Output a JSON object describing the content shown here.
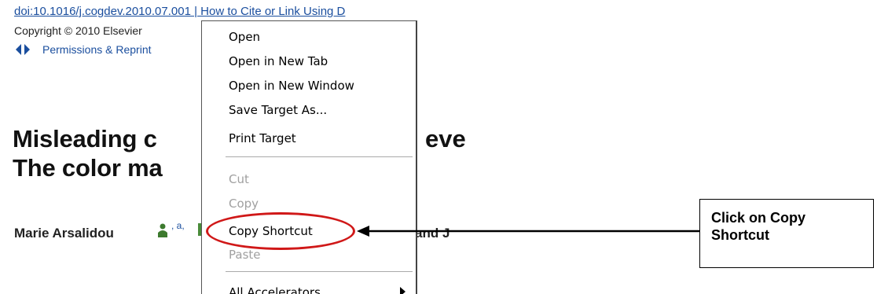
{
  "page": {
    "doi_link": "doi:10.1016/j.cogdev.2010.07.001 | How to Cite or Link Using D",
    "copyright": "Copyright © 2010 Elsevier",
    "permissions": "Permissions & Reprint",
    "title_line1": "Misleading c",
    "title_line1_tail": "eve",
    "title_line2": "The color ma",
    "author": "Marie Arsalidou",
    "author_sup": ", a,",
    "author_tail": "and J"
  },
  "context_menu": {
    "items": [
      {
        "label": "Open",
        "enabled": true
      },
      {
        "label": "Open in New Tab",
        "enabled": true
      },
      {
        "label": "Open in New Window",
        "enabled": true
      },
      {
        "label": "Save Target As...",
        "enabled": true
      },
      {
        "label": "Print Target",
        "enabled": true
      },
      {
        "label": "Cut",
        "enabled": false
      },
      {
        "label": "Copy",
        "enabled": false
      },
      {
        "label": "Copy Shortcut",
        "enabled": true
      },
      {
        "label": "Paste",
        "enabled": false
      },
      {
        "label": "All Accelerators",
        "enabled": true
      }
    ]
  },
  "annotation": {
    "callout_text": "Click on Copy Shortcut",
    "highlight_color": "#d01818",
    "target_item": "Copy Shortcut"
  },
  "colors": {
    "link": "#1a4e9e",
    "disabled": "#a0a0a0"
  }
}
